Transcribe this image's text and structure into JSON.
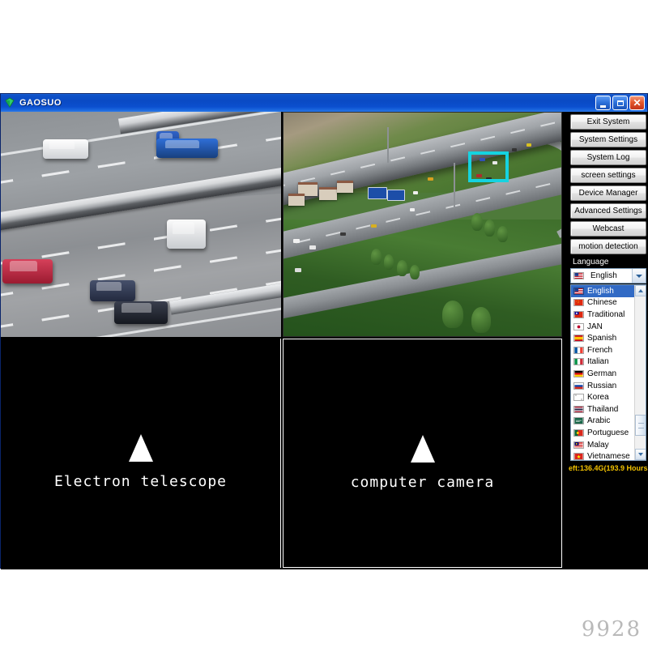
{
  "window": {
    "title": "GAOSUO",
    "icon": "gem-icon",
    "controls": {
      "minimize": "_",
      "maximize": "□",
      "close": "✕"
    }
  },
  "video_grid": {
    "cells": [
      {
        "id": "top-left",
        "type": "live",
        "scene": "highway-traffic-cameras",
        "label": ""
      },
      {
        "id": "top-right",
        "type": "live",
        "scene": "aerial-highway-interchange",
        "label": "",
        "detection_box": true
      },
      {
        "id": "bottom-left",
        "type": "blank",
        "label": "Electron telescope"
      },
      {
        "id": "bottom-right",
        "type": "blank",
        "label": "computer camera"
      }
    ]
  },
  "sidebar": {
    "buttons": [
      {
        "label": "Exit System"
      },
      {
        "label": "System Settings"
      },
      {
        "label": "System Log"
      },
      {
        "label": "screen settings"
      },
      {
        "label": "Device Manager"
      },
      {
        "label": "Advanced Settings"
      },
      {
        "label": "Webcast"
      },
      {
        "label": "motion detection"
      }
    ],
    "language_label": "Language",
    "language_selected": "English",
    "language_options": [
      {
        "label": "English",
        "flag": "us"
      },
      {
        "label": "Chinese",
        "flag": "cn"
      },
      {
        "label": "Traditional",
        "flag": "tw"
      },
      {
        "label": "JAN",
        "flag": "jp"
      },
      {
        "label": "Spanish",
        "flag": "es"
      },
      {
        "label": "French",
        "flag": "fr"
      },
      {
        "label": "Italian",
        "flag": "it"
      },
      {
        "label": "German",
        "flag": "de"
      },
      {
        "label": "Russian",
        "flag": "ru"
      },
      {
        "label": "Korea",
        "flag": "kr"
      },
      {
        "label": "Thailand",
        "flag": "th"
      },
      {
        "label": "Arabic",
        "flag": "sa"
      },
      {
        "label": "Portuguese",
        "flag": "pt"
      },
      {
        "label": "Malay",
        "flag": "my"
      },
      {
        "label": "Vietnamese",
        "flag": "vn"
      }
    ],
    "disk_status": "eft:136.4G(193.9 Hours"
  },
  "watermark": "9928",
  "colors": {
    "titlebar_blue": "#0a4ac4",
    "detection_box": "#15d3e0",
    "selection_blue": "#316ac5",
    "disk_status_text": "#f2c200"
  }
}
